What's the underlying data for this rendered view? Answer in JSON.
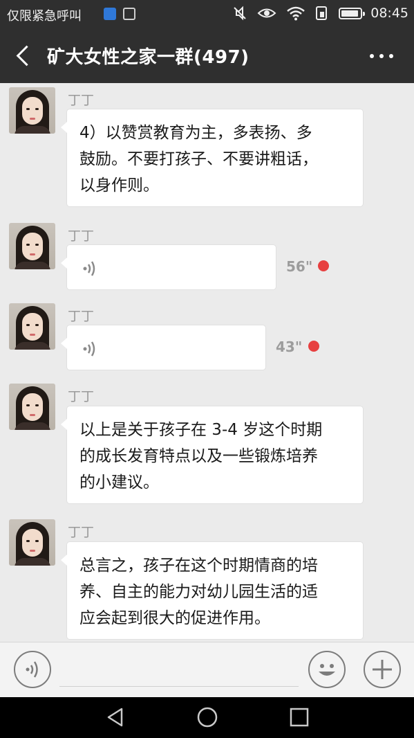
{
  "status_bar": {
    "carrier_text": "仅限紧急呼叫",
    "time": "08:45"
  },
  "header": {
    "title": "矿大女性之家一群(497)"
  },
  "messages": [
    {
      "sender": "丁丁",
      "type": "text",
      "text": "4）以赞赏教育为主，多表扬、多\n鼓励。不要打孩子、不要讲粗话，\n以身作则。"
    },
    {
      "sender": "丁丁",
      "type": "voice",
      "duration": "56\"",
      "unread": true
    },
    {
      "sender": "丁丁",
      "type": "voice",
      "duration": "43\"",
      "unread": true
    },
    {
      "sender": "丁丁",
      "type": "text",
      "text": "以上是关于孩子在 3-4 岁这个时期\n的成长发育特点以及一些锻炼培养\n的小建议。"
    },
    {
      "sender": "丁丁",
      "type": "text",
      "text": "总言之，孩子在这个时期情商的培\n养、自主的能力对幼儿园生活的适\n应会起到很大的促进作用。"
    }
  ],
  "colors": {
    "header_bg": "#2f2f2f",
    "chat_bg": "#ebebeb",
    "bubble_bg": "#ffffff",
    "unread_dot": "#e74040"
  },
  "icons": {
    "back": "chevron-left-icon",
    "more": "more-dots-icon",
    "voice_toggle": "voice-icon",
    "emoji": "emoji-icon",
    "add": "plus-icon"
  }
}
